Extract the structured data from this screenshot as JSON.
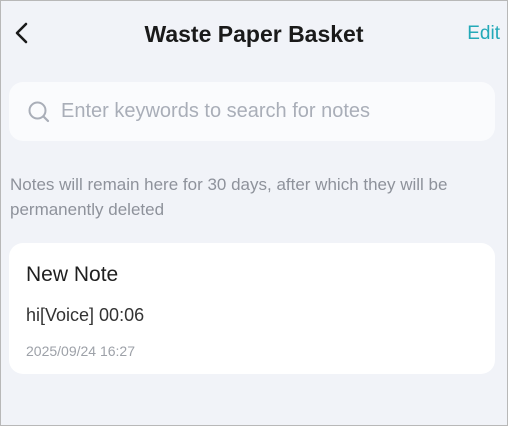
{
  "header": {
    "title": "Waste Paper Basket",
    "edit_label": "Edit",
    "back_icon": "chevron-left-icon"
  },
  "search": {
    "icon": "search-icon",
    "placeholder": "Enter keywords to search for notes",
    "value": ""
  },
  "notice": {
    "text": "Notes will remain here for 30 days, after which they will be permanently deleted"
  },
  "notes": [
    {
      "title": "New Note",
      "preview": "hi[Voice] 00:06",
      "date": "2025/09/24 16:27"
    }
  ],
  "colors": {
    "accent": "#23a9b8",
    "background": "#f1f3f8",
    "card": "#ffffff"
  }
}
